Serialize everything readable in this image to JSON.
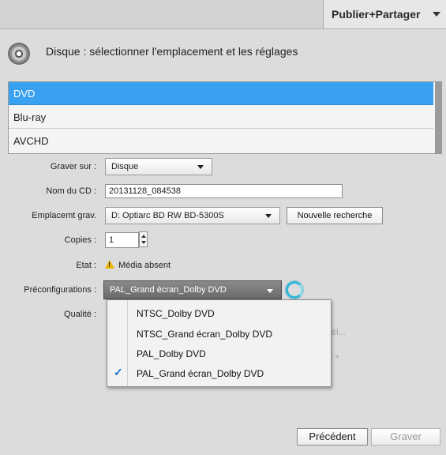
{
  "top_tab": {
    "label": "Publier+Partager"
  },
  "header": {
    "title": "Disque : sélectionner l'emplacement et les réglages"
  },
  "media_list": {
    "items": [
      {
        "label": "DVD",
        "selected": true
      },
      {
        "label": "Blu-ray",
        "selected": false
      },
      {
        "label": "AVCHD",
        "selected": false
      }
    ]
  },
  "form": {
    "graver_sur": {
      "label": "Graver sur :",
      "value": "Disque"
    },
    "nom_cd": {
      "label": "Nom du CD :",
      "value": "20131128_084538"
    },
    "emplacement": {
      "label": "Emplacemt grav.",
      "value": "D: Optiarc BD RW BD-5300S"
    },
    "nouvelle_recherche": "Nouvelle recherche",
    "copies": {
      "label": "Copies :",
      "value": "1"
    },
    "etat": {
      "label": "Etat :",
      "value": "Média absent"
    },
    "preconfigurations": {
      "label": "Préconfigurations :",
      "value": "PAL_Grand écran_Dolby DVD"
    },
    "qualite": {
      "label": "Qualité :"
    }
  },
  "dropdown": {
    "options": [
      {
        "label": "NTSC_Dolby DVD",
        "checked": false
      },
      {
        "label": "NTSC_Grand écran_Dolby DVD",
        "checked": false
      },
      {
        "label": "PAL_Dolby DVD",
        "checked": false
      },
      {
        "label": "PAL_Grand écran_Dolby DVD",
        "checked": true
      }
    ],
    "check_glyph": "✓"
  },
  "hidden_fragments": {
    "right1": "él...",
    "right2": "+"
  },
  "footer": {
    "precedent": "Précédent",
    "graver": "Graver"
  },
  "icons": {
    "disc": "disc-icon",
    "warning": "warning-icon",
    "spinner": "spinner-icon"
  },
  "colors": {
    "selection": "#3aa0f0",
    "warning": "#f2b600",
    "accent": "#2fb7d8"
  }
}
